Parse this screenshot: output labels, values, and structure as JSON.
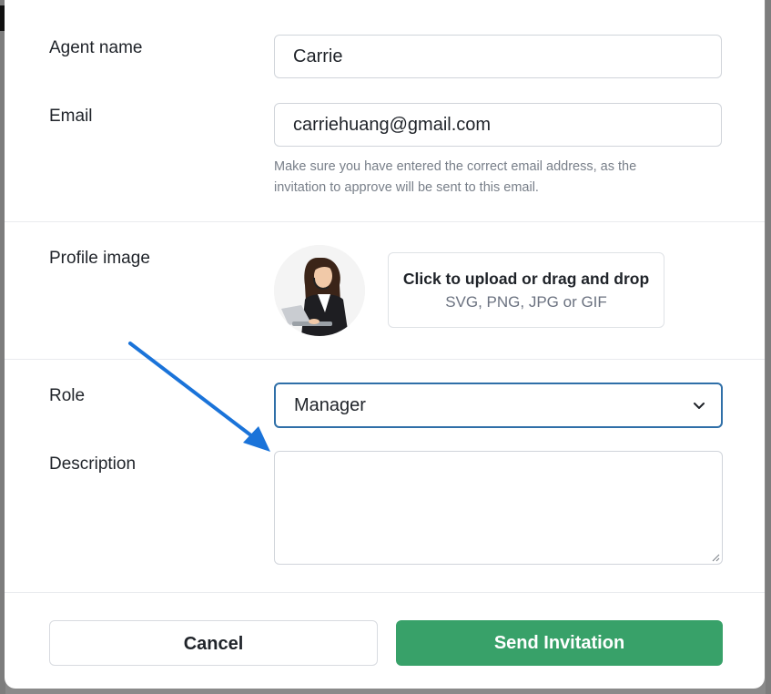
{
  "form": {
    "agent_name": {
      "label": "Agent name",
      "value": "Carrie"
    },
    "email": {
      "label": "Email",
      "value": "carriehuang@gmail.com",
      "help_line1": "Make sure you have entered the correct email address, as the",
      "help_line2": "invitation to approve will be sent to this email."
    },
    "profile_image": {
      "label": "Profile image",
      "upload_title": "Click to upload or drag and drop",
      "upload_formats": "SVG, PNG, JPG or GIF"
    },
    "role": {
      "label": "Role",
      "value": "Manager"
    },
    "description": {
      "label": "Description",
      "value": ""
    }
  },
  "actions": {
    "cancel_label": "Cancel",
    "send_label": "Send Invitation"
  },
  "colors": {
    "primary": "#38a169",
    "focus_border": "#2f6fa8",
    "annotation_arrow": "#1a73d9"
  },
  "icons": [
    "chevron-down-icon",
    "resize-handle-icon",
    "arrow-annotation"
  ]
}
